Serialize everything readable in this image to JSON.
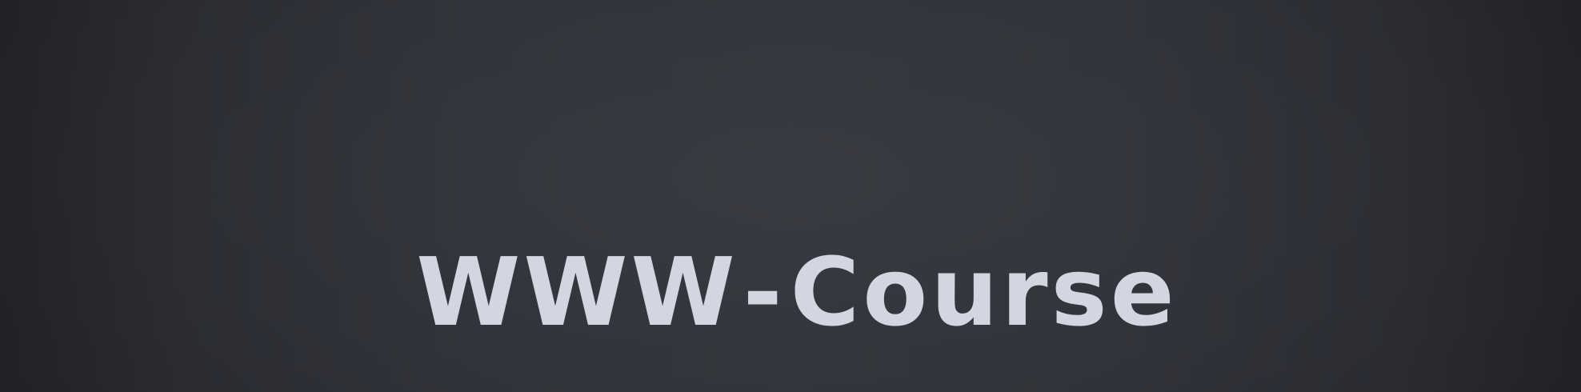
{
  "hero": {
    "title_part1": "WWW",
    "title_separator": "-",
    "title_part2": "Course"
  },
  "colors": {
    "background": "#2f3137",
    "text": "#d3d6e0"
  }
}
